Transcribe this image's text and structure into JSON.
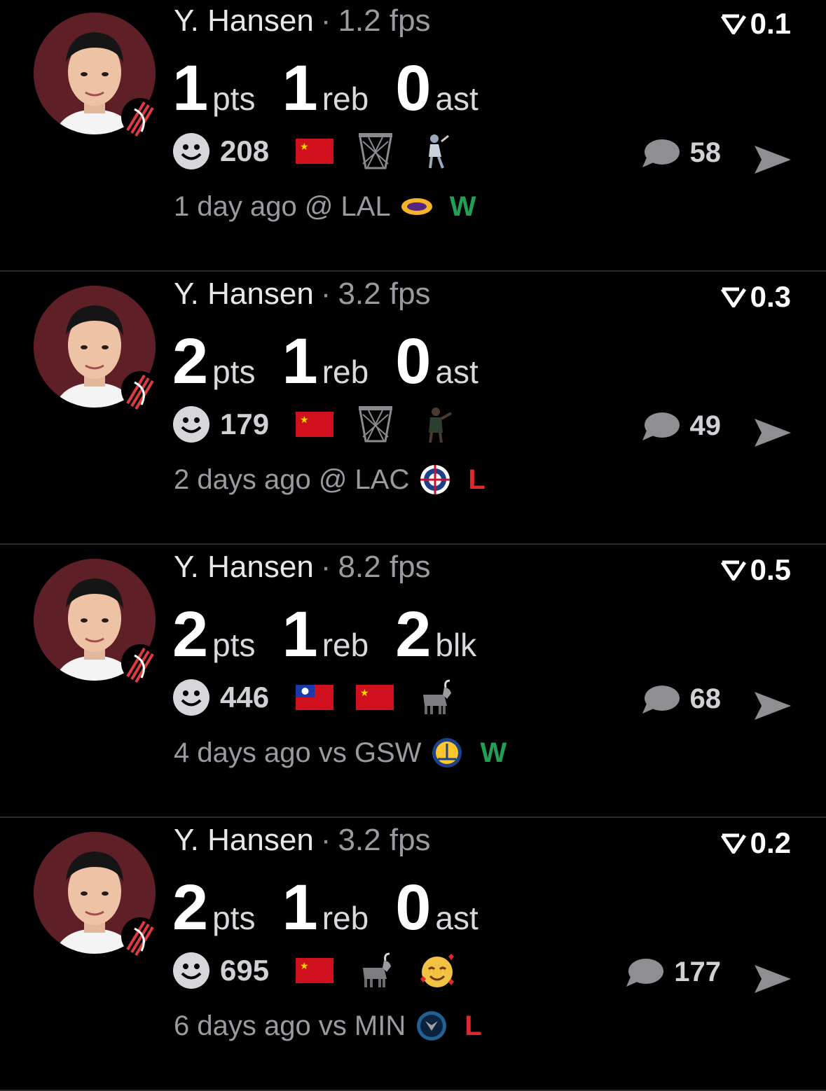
{
  "feed": [
    {
      "player": "Y. Hansen",
      "fps": "1.2 fps",
      "rating": "0.1",
      "stats": [
        {
          "num": "1",
          "unit": "pts"
        },
        {
          "num": "1",
          "unit": "reb"
        },
        {
          "num": "0",
          "unit": "ast"
        }
      ],
      "reaction_count": "208",
      "comment_count": "58",
      "game": "1 day ago @ LAL",
      "result": "W",
      "result_color": "#1fa055",
      "reaction_icons": [
        "china-flag",
        "basketball-hoop",
        "fan-figure"
      ]
    },
    {
      "player": "Y. Hansen",
      "fps": "3.2 fps",
      "rating": "0.3",
      "stats": [
        {
          "num": "2",
          "unit": "pts"
        },
        {
          "num": "1",
          "unit": "reb"
        },
        {
          "num": "0",
          "unit": "ast"
        }
      ],
      "reaction_count": "179",
      "comment_count": "49",
      "game": "2 days ago @ LAC",
      "result": "L",
      "result_color": "#e0262e",
      "reaction_icons": [
        "china-flag",
        "basketball-hoop",
        "player-figure"
      ]
    },
    {
      "player": "Y. Hansen",
      "fps": "8.2 fps",
      "rating": "0.5",
      "stats": [
        {
          "num": "2",
          "unit": "pts"
        },
        {
          "num": "1",
          "unit": "reb"
        },
        {
          "num": "2",
          "unit": "blk"
        }
      ],
      "reaction_count": "446",
      "comment_count": "68",
      "game": "4 days ago vs GSW",
      "result": "W",
      "result_color": "#1fa055",
      "reaction_icons": [
        "taiwan-flag",
        "china-flag",
        "goat"
      ]
    },
    {
      "player": "Y. Hansen",
      "fps": "3.2 fps",
      "rating": "0.2",
      "stats": [
        {
          "num": "2",
          "unit": "pts"
        },
        {
          "num": "1",
          "unit": "reb"
        },
        {
          "num": "0",
          "unit": "ast"
        }
      ],
      "reaction_count": "695",
      "comment_count": "177",
      "game": "6 days ago vs MIN",
      "result": "L",
      "result_color": "#e0262e",
      "reaction_icons": [
        "china-flag",
        "goat",
        "smiling-hearts-face"
      ]
    }
  ],
  "colors": {
    "background": "#000000",
    "avatar_bg": "#5e1f26",
    "win": "#1fa055",
    "loss": "#e0262e",
    "muted": "#9a9aa0"
  }
}
